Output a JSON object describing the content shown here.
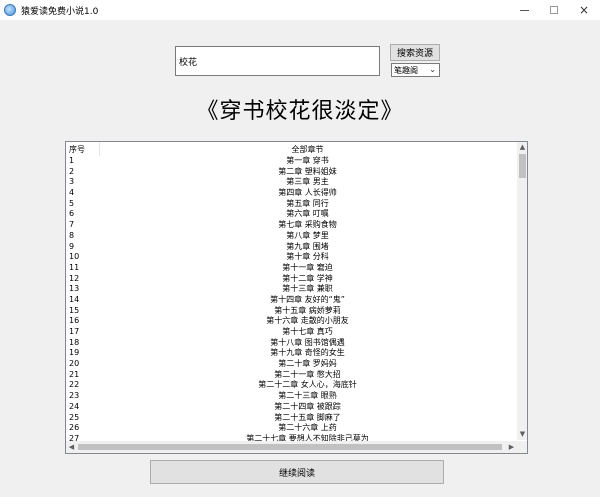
{
  "window": {
    "title": "猿爱读免费小说1.0",
    "icon": "app-icon",
    "controls": {
      "minimize": "minimize-icon",
      "maximize": "maximize-icon",
      "close": "×"
    }
  },
  "search": {
    "value": "校花",
    "button_label": "搜索资源",
    "source_selected": "笔趣阁",
    "source_dropdown_icon": "chevron-down-icon"
  },
  "book": {
    "title": "《穿书校花很淡定》"
  },
  "chapter_list": {
    "headers": {
      "index": "序号",
      "chapter": "全部章节"
    },
    "rows": [
      {
        "index": "1",
        "chapter": "第一章 穿书"
      },
      {
        "index": "2",
        "chapter": "第二章 塑料姐妹"
      },
      {
        "index": "3",
        "chapter": "第三章 男主"
      },
      {
        "index": "4",
        "chapter": "第四章 人长得帅"
      },
      {
        "index": "5",
        "chapter": "第五章 同行"
      },
      {
        "index": "6",
        "chapter": "第六章 叮嘱"
      },
      {
        "index": "7",
        "chapter": "第七章 采购食物"
      },
      {
        "index": "8",
        "chapter": "第八章 梦里"
      },
      {
        "index": "9",
        "chapter": "第九章 围堵"
      },
      {
        "index": "10",
        "chapter": "第十章 分科"
      },
      {
        "index": "11",
        "chapter": "第十一章 窘迫"
      },
      {
        "index": "12",
        "chapter": "第十二章 学神"
      },
      {
        "index": "13",
        "chapter": "第十三章 兼职"
      },
      {
        "index": "14",
        "chapter": "第十四章 友好的“鬼”"
      },
      {
        "index": "15",
        "chapter": "第十五章 病娇萝莉"
      },
      {
        "index": "16",
        "chapter": "第十六章 走散的小朋友"
      },
      {
        "index": "17",
        "chapter": "第十七章 真巧"
      },
      {
        "index": "18",
        "chapter": "第十八章 图书馆偶遇"
      },
      {
        "index": "19",
        "chapter": "第十九章 奇怪的女生"
      },
      {
        "index": "20",
        "chapter": "第二十章 罗妈妈"
      },
      {
        "index": "21",
        "chapter": "第二十一章 憋大招"
      },
      {
        "index": "22",
        "chapter": "第二十二章 女人心，海底针"
      },
      {
        "index": "23",
        "chapter": "第二十三章 眼熟"
      },
      {
        "index": "24",
        "chapter": "第二十四章 被跟踪"
      },
      {
        "index": "25",
        "chapter": "第二十五章 脚麻了"
      },
      {
        "index": "26",
        "chapter": "第二十六章 上药"
      },
      {
        "index": "27",
        "chapter": "第二十七章 要想人不知除非己莫为"
      }
    ]
  },
  "footer": {
    "continue_label": "继续阅读"
  }
}
